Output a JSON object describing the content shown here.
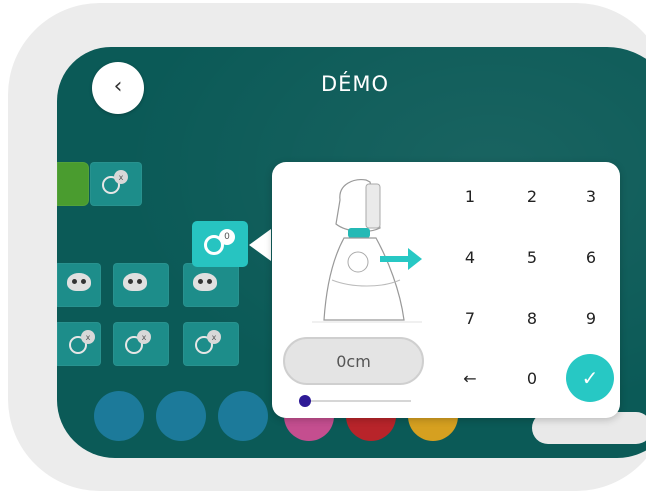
{
  "header": {
    "title": "DÉMO",
    "back_icon": "‹"
  },
  "blocks": {
    "badge": "x",
    "selected_badge": "0"
  },
  "distance": {
    "value": "0cm",
    "slider_fraction": 0
  },
  "keypad": {
    "keys": [
      "1",
      "2",
      "3",
      "4",
      "5",
      "6",
      "7",
      "8",
      "9"
    ],
    "backspace": "←",
    "zero": "0",
    "confirm": "✓"
  },
  "colors": {
    "screen_bg": "#0b5a57",
    "accent": "#27c8c4",
    "slider_thumb": "#2e1a96"
  }
}
